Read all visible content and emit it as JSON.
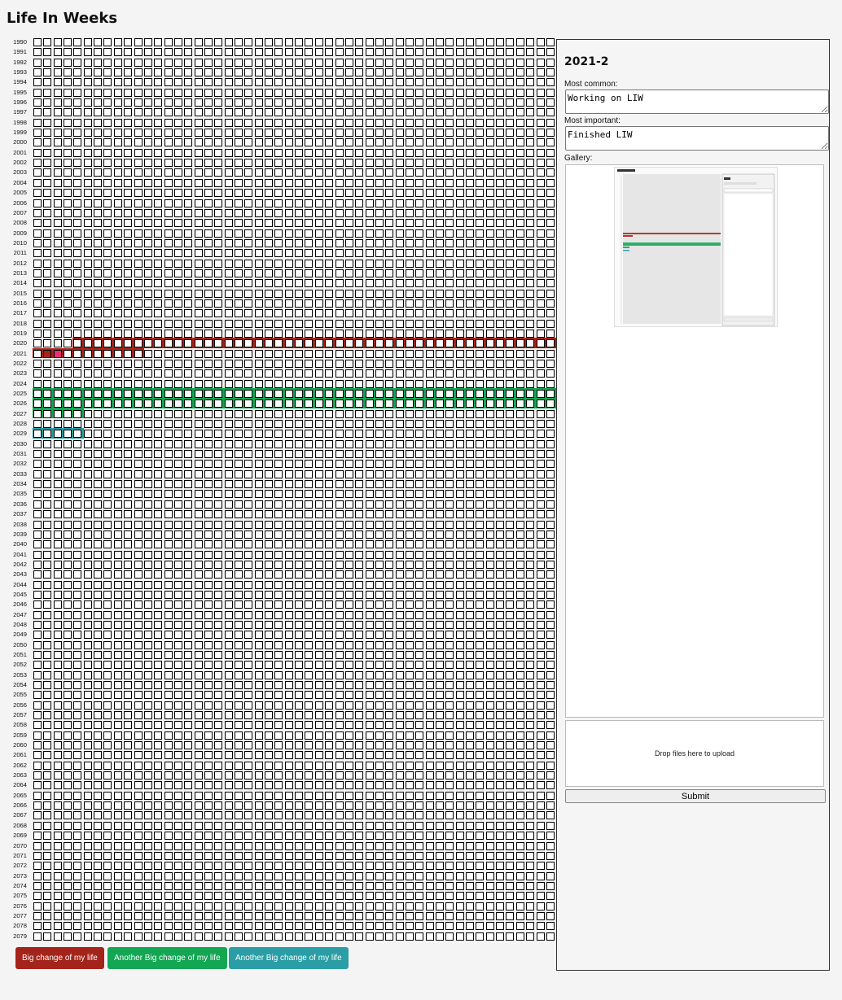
{
  "app": {
    "title": "Life In Weeks"
  },
  "grid": {
    "years": [
      "1990",
      "1991",
      "1992",
      "1993",
      "1994",
      "1995",
      "1996",
      "1997",
      "1998",
      "1999",
      "2000",
      "2001",
      "2002",
      "2003",
      "2004",
      "2005",
      "2006",
      "2007",
      "2008",
      "2009",
      "2010",
      "2011",
      "2012",
      "2013",
      "2014",
      "2015",
      "2016",
      "2017",
      "2018",
      "2019",
      "2020",
      "2021",
      "2022",
      "2023",
      "2024",
      "2025",
      "2026",
      "2027",
      "2028",
      "2029",
      "2030",
      "2031",
      "2032",
      "2033",
      "2034",
      "2035",
      "2036",
      "2037",
      "2038",
      "2039",
      "2040",
      "2041",
      "2042",
      "2043",
      "2044",
      "2045",
      "2046",
      "2047",
      "2048",
      "2049",
      "2050",
      "2051",
      "2052",
      "2053",
      "2054",
      "2055",
      "2056",
      "2057",
      "2058",
      "2059",
      "2060",
      "2061",
      "2062",
      "2063",
      "2064",
      "2065",
      "2066",
      "2067",
      "2068",
      "2069",
      "2070",
      "2071",
      "2072",
      "2073",
      "2074",
      "2075",
      "2076",
      "2077",
      "2078",
      "2079"
    ],
    "weeks_per_year": 52,
    "selected_week": "2021-2",
    "periods": [
      {
        "label_ref": 0,
        "color": "#a4231a",
        "start": "2020-5",
        "end": "2021-11"
      },
      {
        "label_ref": 1,
        "color": "#13a653",
        "start": "2025-1",
        "end": "2027-5"
      },
      {
        "label_ref": 2,
        "color": "#2a9da5",
        "start": "2029-1",
        "end": "2029-5"
      }
    ],
    "highlight_color": "#e8306e"
  },
  "panel": {
    "title": "2021-2",
    "most_common_label": "Most common:",
    "most_common_value": "Working on LIW",
    "most_important_label": "Most important:",
    "most_important_value": "Finished LIW",
    "gallery_label": "Gallery:",
    "dropzone_text": "Drop files here to upload",
    "submit_label": "Submit"
  },
  "legend": [
    {
      "label": "Big change of my life",
      "color": "#a4231a"
    },
    {
      "label": "Another Big change of my life",
      "color": "#13a653"
    },
    {
      "label": "Another Big change of my life",
      "color": "#2a9da5"
    }
  ]
}
